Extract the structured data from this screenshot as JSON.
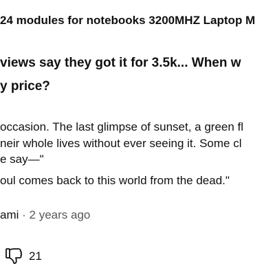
{
  "product": {
    "title": "24 modules for notebooks 3200MHZ Laptop M"
  },
  "question": {
    "line1": "views say they got it for 3.5k... When w",
    "line2": "y price?"
  },
  "answer": {
    "line1": "occasion. The last glimpse of sunset, a green fl",
    "line2": "neir whole lives without ever seeing it. Some cl",
    "line3": "e say—\"",
    "line4": "oul comes back to this world from the dead.\""
  },
  "meta": {
    "author": "ami",
    "separator": "·",
    "time": "2 years ago"
  },
  "votes": {
    "icon": "thumbs-down-icon",
    "count": "21"
  }
}
